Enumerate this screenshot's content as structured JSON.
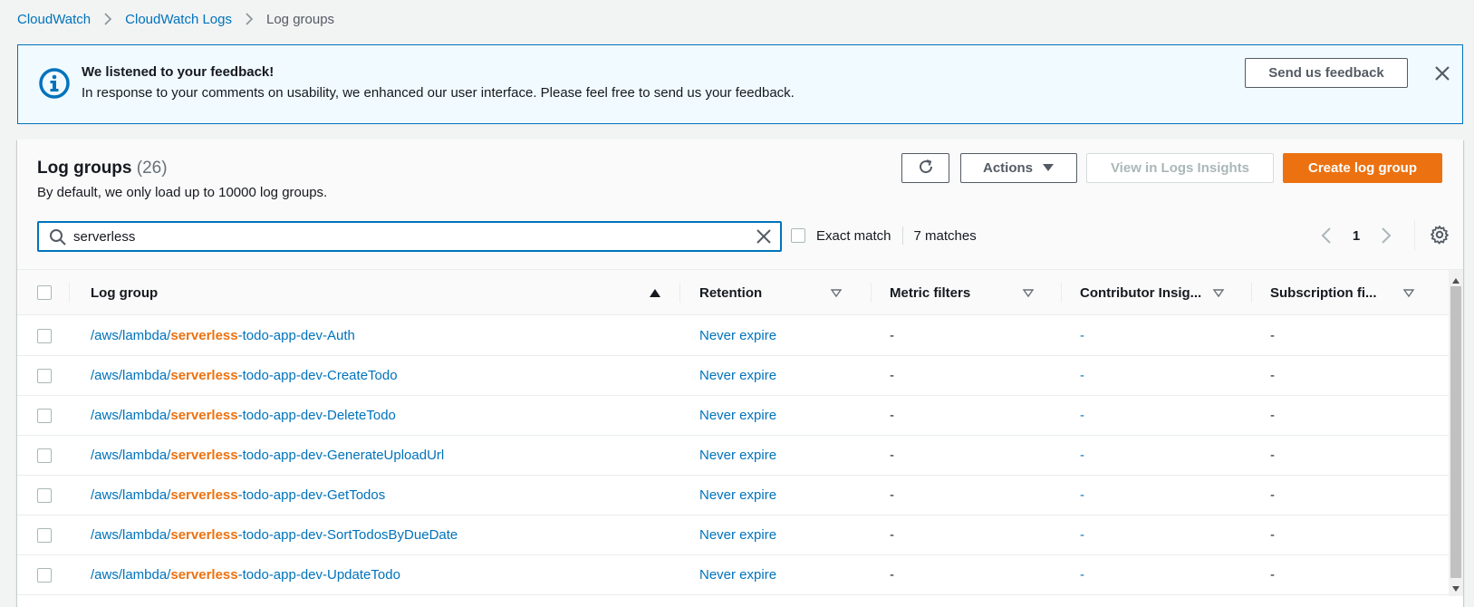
{
  "breadcrumb": {
    "items": [
      "CloudWatch",
      "CloudWatch Logs"
    ],
    "current": "Log groups"
  },
  "flash": {
    "title": "We listened to your feedback!",
    "body": "In response to your comments on usability, we enhanced our user interface. Please feel free to send us your feedback.",
    "button": "Send us feedback",
    "type": "info",
    "border_color": "#0073bb",
    "background_color": "#f1faff"
  },
  "panel": {
    "title": "Log groups",
    "count": "(26)",
    "description": "By default, we only load up to 10000 log groups.",
    "buttons": {
      "actions": "Actions",
      "view_insights": "View in Logs Insights",
      "create": "Create log group"
    },
    "search": {
      "value": "serverless",
      "placeholder": "Filter log groups or try prefix search"
    },
    "exact_match_label": "Exact match",
    "matches": "7 matches",
    "page": "1"
  },
  "table": {
    "columns": [
      "Log group",
      "Retention",
      "Metric filters",
      "Contributor Insig...",
      "Subscription fi..."
    ],
    "rows": [
      {
        "prefix": "/aws/lambda/",
        "match": "serverless",
        "suffix": "-todo-app-dev-Auth",
        "retention": "Never expire",
        "metric_filters": "-",
        "contributor": "-",
        "subscription": "-"
      },
      {
        "prefix": "/aws/lambda/",
        "match": "serverless",
        "suffix": "-todo-app-dev-CreateTodo",
        "retention": "Never expire",
        "metric_filters": "-",
        "contributor": "-",
        "subscription": "-"
      },
      {
        "prefix": "/aws/lambda/",
        "match": "serverless",
        "suffix": "-todo-app-dev-DeleteTodo",
        "retention": "Never expire",
        "metric_filters": "-",
        "contributor": "-",
        "subscription": "-"
      },
      {
        "prefix": "/aws/lambda/",
        "match": "serverless",
        "suffix": "-todo-app-dev-GenerateUploadUrl",
        "retention": "Never expire",
        "metric_filters": "-",
        "contributor": "-",
        "subscription": "-"
      },
      {
        "prefix": "/aws/lambda/",
        "match": "serverless",
        "suffix": "-todo-app-dev-GetTodos",
        "retention": "Never expire",
        "metric_filters": "-",
        "contributor": "-",
        "subscription": "-"
      },
      {
        "prefix": "/aws/lambda/",
        "match": "serverless",
        "suffix": "-todo-app-dev-SortTodosByDueDate",
        "retention": "Never expire",
        "metric_filters": "-",
        "contributor": "-",
        "subscription": "-"
      },
      {
        "prefix": "/aws/lambda/",
        "match": "serverless",
        "suffix": "-todo-app-dev-UpdateTodo",
        "retention": "Never expire",
        "metric_filters": "-",
        "contributor": "-",
        "subscription": "-"
      }
    ]
  },
  "colors": {
    "link": "#0073bb",
    "accent": "#ec7211",
    "highlight": "#ec7211"
  },
  "icons": {
    "info": "info-icon",
    "close": "close-icon",
    "refresh": "refresh-icon",
    "caret": "caret-down-icon",
    "search": "search-icon",
    "clear": "clear-icon",
    "prev": "chevron-left-icon",
    "next": "chevron-right-icon",
    "settings": "gear-icon",
    "sort_asc": "sort-ascending-icon",
    "sort": "sort-icon"
  }
}
